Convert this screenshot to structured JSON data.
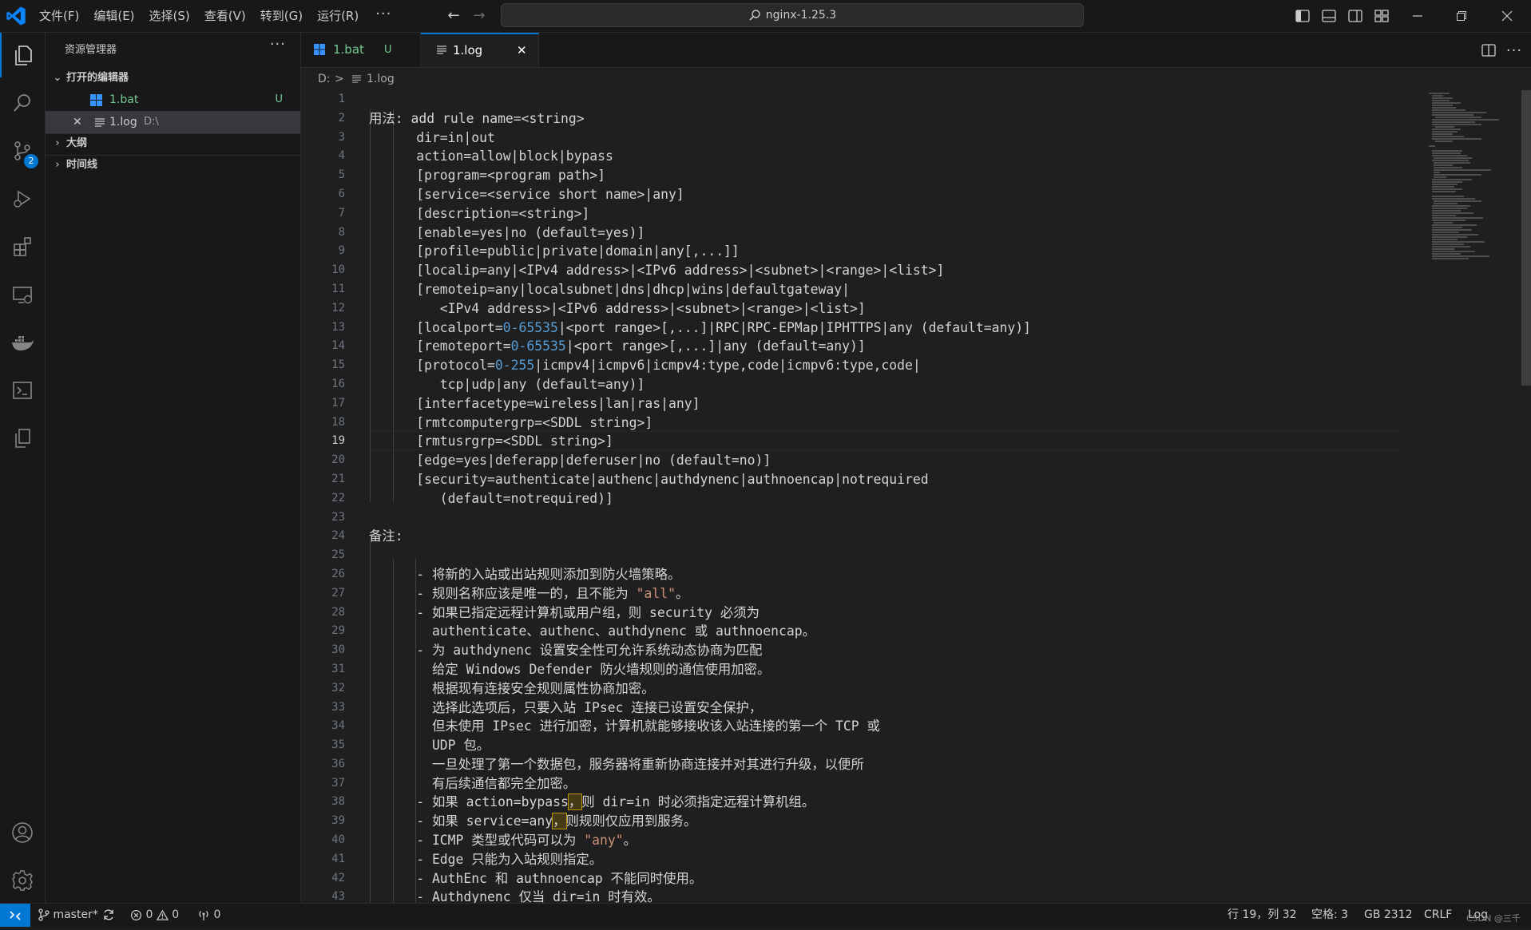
{
  "titlebar": {
    "menus": [
      "文件(F)",
      "编辑(E)",
      "选择(S)",
      "查看(V)",
      "转到(G)",
      "运行(R)"
    ],
    "more": "···",
    "search_text": "nginx-1.25.3"
  },
  "activitybar": {
    "icons": [
      "files-icon",
      "search-icon",
      "source-control-icon",
      "run-debug-icon",
      "extensions-icon",
      "remote-explorer-icon",
      "docker-icon",
      "terminal-icon",
      "copy-icon",
      "account-icon",
      "settings-gear-icon"
    ],
    "source_control_badge": "2"
  },
  "sidebar": {
    "title": "资源管理器",
    "more": "···",
    "open_editors_label": "打开的编辑器",
    "open_editors": [
      {
        "name": "1.bat",
        "status": "U",
        "color": "#73c991"
      },
      {
        "name": "1.log",
        "path": "D:\\",
        "close": "✕"
      }
    ],
    "outline_label": "大纲",
    "timeline_label": "时间线"
  },
  "tabs": [
    {
      "label": "1.bat",
      "status": "U"
    },
    {
      "label": "1.log",
      "close": "✕"
    }
  ],
  "breadcrumb": {
    "drive": "D:",
    "sep": ">",
    "file": "1.log"
  },
  "editor": {
    "current_line": 19,
    "lines": [
      "",
      "用法: add rule name=<string>",
      "      dir=in|out",
      "      action=allow|block|bypass",
      "      [program=<program path>]",
      "      [service=<service short name>|any]",
      "      [description=<string>]",
      "      [enable=yes|no (default=yes)]",
      "      [profile=public|private|domain|any[,...]]",
      "      [localip=any|<IPv4 address>|<IPv6 address>|<subnet>|<range>|<list>]",
      "      [remoteip=any|localsubnet|dns|dhcp|wins|defaultgateway|",
      "         <IPv4 address>|<IPv6 address>|<subnet>|<range>|<list>]",
      "      [localport=0-65535|<port range>[,...]|RPC|RPC-EPMap|IPHTTPS|any (default=any)]",
      "      [remoteport=0-65535|<port range>[,...]|any (default=any)]",
      "      [protocol=0-255|icmpv4|icmpv6|icmpv4:type,code|icmpv6:type,code|",
      "         tcp|udp|any (default=any)]",
      "      [interfacetype=wireless|lan|ras|any]",
      "      [rmtcomputergrp=<SDDL string>]",
      "      [rmtusrgrp=<SDDL string>]",
      "      [edge=yes|deferapp|deferuser|no (default=no)]",
      "      [security=authenticate|authenc|authdynenc|authnoencap|notrequired",
      "         (default=notrequired)]",
      "",
      "备注:",
      "",
      "      - 将新的入站或出站规则添加到防火墙策略。",
      "      - 规则名称应该是唯一的，且不能为 \"all\"。",
      "      - 如果已指定远程计算机或用户组，则 security 必须为",
      "        authenticate、authenc、authdynenc 或 authnoencap。",
      "      - 为 authdynenc 设置安全性可允许系统动态协商为匹配",
      "        给定 Windows Defender 防火墙规则的通信使用加密。",
      "        根据现有连接安全规则属性协商加密。",
      "        选择此选项后，只要入站 IPsec 连接已设置安全保护，",
      "        但未使用 IPsec 进行加密，计算机就能够接收该入站连接的第一个 TCP 或",
      "        UDP 包。",
      "        一旦处理了第一个数据包，服务器将重新协商连接并对其进行升级，以便所",
      "        有后续通信都完全加密。",
      "      - 如果 action=bypass，则 dir=in 时必须指定远程计算机组。",
      "      - 如果 service=any，则规则仅应用到服务。",
      "      - ICMP 类型或代码可以为 \"any\"。",
      "      - Edge 只能为入站规则指定。",
      "      - AuthEnc 和 authnoencap 不能同时使用。",
      "      - Authdynenc 仅当 dir=in 时有效。"
    ]
  },
  "statusbar": {
    "branch": "master*",
    "errors": "0",
    "warnings": "0",
    "ports": "0",
    "position": "行 19，列 32",
    "spaces": "空格: 3",
    "encoding": "GB 2312",
    "eol": "CRLF",
    "language": "Log",
    "watermark": "CSDN @三千"
  },
  "colors": {
    "accent": "#0078d4",
    "untracked": "#73c991",
    "number": "#569cd6",
    "string": "#ce9178"
  }
}
